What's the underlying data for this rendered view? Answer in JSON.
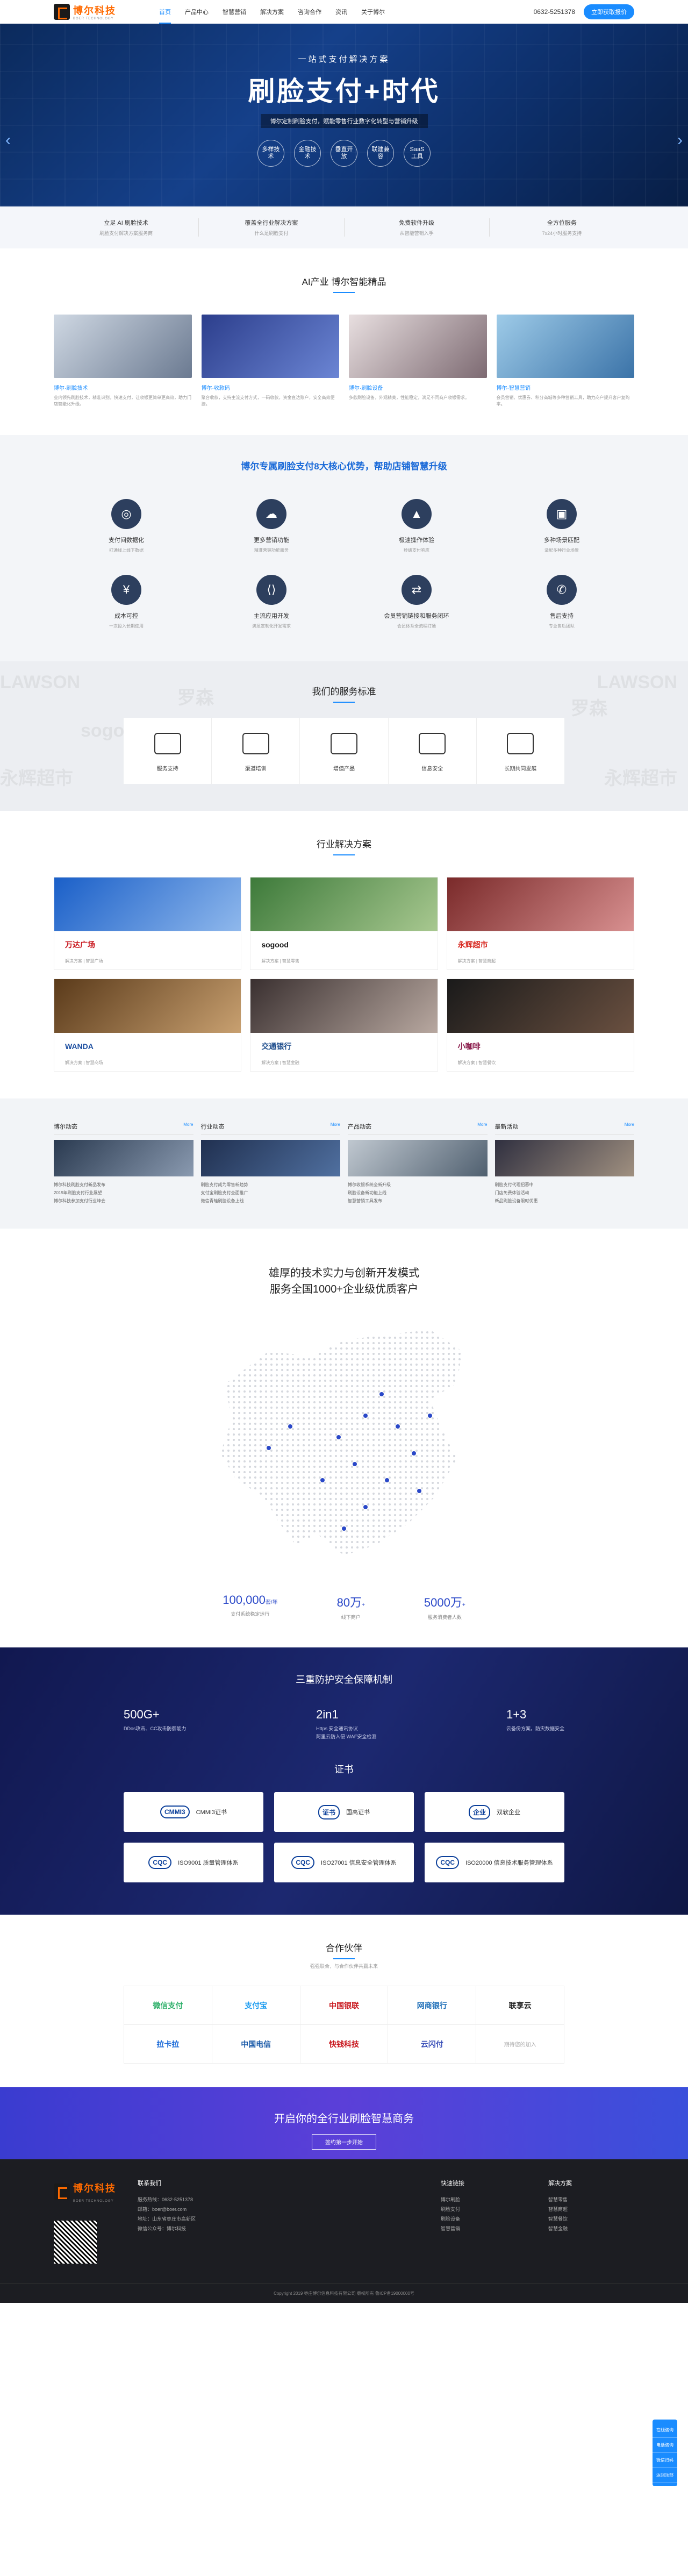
{
  "header": {
    "brand_name": "博尔科技",
    "brand_sub": "BOER TECHNOLOGY",
    "nav": [
      "首页",
      "产品中心",
      "智慧营销",
      "解决方案",
      "咨询合作",
      "资讯",
      "关于博尔"
    ],
    "phone": "0632-5251378",
    "cta": "立即获取报价"
  },
  "banner": {
    "subtitle": "一站式支付解决方案",
    "title": "刷脸支付+时代",
    "desc": "博尔定制刷脸支付，赋能零售行业数字化转型与营销升级",
    "tags": [
      "多样技术",
      "金融技术",
      "垂直开放",
      "联建兼容",
      "SaaS工具"
    ]
  },
  "strip": [
    {
      "t": "立足 AI 刷脸技术",
      "s": "刷脸支付解决方案服务商"
    },
    {
      "t": "覆盖全行业解决方案",
      "s": "什么是刷脸支付"
    },
    {
      "t": "免费软件升级",
      "s": "从智能营销入手"
    },
    {
      "t": "全方位服务",
      "s": "7x24小时服务支持"
    }
  ],
  "products": {
    "title": "AI产业 博尔智能精品",
    "items": [
      {
        "name": "博尔·刷脸技术",
        "desc": "业内领先刷脸技术，精准识别，快速支付，让收银更简单更高效，助力门店智能化升级。"
      },
      {
        "name": "博尔·收款码",
        "desc": "聚合收款，支持主流支付方式，一码收款，资金直达账户，安全高效便捷。"
      },
      {
        "name": "博尔·刷脸设备",
        "desc": "多款刷脸设备，外观精美，性能稳定，满足不同商户收银需求。"
      },
      {
        "name": "博尔·智慧营销",
        "desc": "会员营销、优惠券、积分商城等多种营销工具，助力商户提升客户复购率。"
      }
    ]
  },
  "advantages": {
    "title": "博尔专属刷脸支付8大核心优势，帮助店铺智慧升级",
    "items": [
      {
        "t": "支付间数据化",
        "s": "打通线上线下数据"
      },
      {
        "t": "更多营销功能",
        "s": "精准营销功能服务"
      },
      {
        "t": "极速操作体验",
        "s": "秒级支付响应"
      },
      {
        "t": "多种场景匹配",
        "s": "适配多种行业场景"
      },
      {
        "t": "成本可控",
        "s": "一次投入长期使用"
      },
      {
        "t": "主流应用开发",
        "s": "满足定制化开发需求"
      },
      {
        "t": "会员营销链接和服务闭环",
        "s": "会员体系全流程打通"
      },
      {
        "t": "售后支持",
        "s": "专业售后团队"
      }
    ]
  },
  "service": {
    "title": "我们的服务标准",
    "bg_words": [
      "LAWSON",
      "sogood",
      "LAWSON",
      "永辉超市",
      "永辉超市",
      "罗森",
      "罗森"
    ],
    "items": [
      "服务支持",
      "渠道培训",
      "增值产品",
      "信息安全",
      "长期共同发展"
    ]
  },
  "solutions": {
    "title": "行业解决方案",
    "items": [
      {
        "logo": "万达广场",
        "meta": "解决方案 | 智慧广场"
      },
      {
        "logo": "sogood",
        "meta": "解决方案 | 智慧零售"
      },
      {
        "logo": "永辉超市",
        "meta": "解决方案 | 智慧商超"
      },
      {
        "logo": "WANDA",
        "meta": "解决方案 | 智慧商场"
      },
      {
        "logo": "交通银行",
        "meta": "解决方案 | 智慧金融"
      },
      {
        "logo": "小咖啡",
        "meta": "解决方案 | 智慧餐饮"
      }
    ]
  },
  "news": {
    "more": "More",
    "cols": [
      {
        "title": "博尔动态",
        "items": [
          "博尔科技刷脸支付新品发布",
          "2019年刷脸支付行业展望",
          "博尔科技参加支付行业峰会"
        ]
      },
      {
        "title": "行业动态",
        "items": [
          "刷脸支付成为零售新趋势",
          "支付宝刷脸支付全面推广",
          "微信青蛙刷脸设备上线"
        ]
      },
      {
        "title": "产品动态",
        "items": [
          "博尔收银系统全新升级",
          "刷脸设备新功能上线",
          "智慧营销工具发布"
        ]
      },
      {
        "title": "最新活动",
        "items": [
          "刷脸支付代理招募中",
          "门店免费体验活动",
          "新品刷脸设备限时优惠"
        ]
      }
    ]
  },
  "mapsec": {
    "title_line1": "雄厚的技术实力与创新开发模式",
    "title_line2": "服务全国1000+企业级优质客户",
    "stats": [
      {
        "v": "100,000",
        "u": "套/年",
        "l": "支付系统稳定运行"
      },
      {
        "v": "80万",
        "u": "+",
        "l": "线下商户"
      },
      {
        "v": "5000万",
        "u": "+",
        "l": "服务消费者人数"
      }
    ]
  },
  "security": {
    "title": "三重防护安全保障机制",
    "items": [
      {
        "v": "500G+",
        "d": "DDos攻击、CC攻击防御能力"
      },
      {
        "v": "2in1",
        "d": "Https 安全通讯协议\n阿里云防入侵 WAF安全检测"
      },
      {
        "v": "1+3",
        "d": "云备份方案，防灾数据安全"
      }
    ],
    "cert_title": "证书",
    "certs": [
      {
        "logo": "CMMI3",
        "name": "CMMI3证书"
      },
      {
        "logo": "证书",
        "name": "国高证书"
      },
      {
        "logo": "企业",
        "name": "双软企业"
      },
      {
        "logo": "CQC",
        "name": "ISO9001 质量管理体系"
      },
      {
        "logo": "CQC",
        "name": "ISO27001 信息安全管理体系"
      },
      {
        "logo": "CQC",
        "name": "ISO20000 信息技术服务管理体系"
      }
    ]
  },
  "partners": {
    "title": "合作伙伴",
    "sub": "强强联合，与合作伙伴共赢未来",
    "items": [
      "微信支付",
      "支付宝",
      "中国银联",
      "网商银行",
      "联享云",
      "拉卡拉",
      "中国电信",
      "快钱科技",
      "云闪付",
      "期待您的加入"
    ]
  },
  "cta": {
    "title": "开启你的全行业刷脸智慧商务",
    "button": "签约第一步开始"
  },
  "footer": {
    "contact_title": "联系我们",
    "contact": [
      "服务热线：0632-5251378",
      "邮箱：boer@boer.com",
      "地址：山东省枣庄市高新区",
      "微信公众号：博尔科技"
    ],
    "links_title": "快速链接",
    "links": [
      "博尔刷脸",
      "刷脸支付",
      "刷脸设备",
      "智慧营销"
    ],
    "sol_title": "解决方案",
    "sols": [
      "智慧零售",
      "智慧商超",
      "智慧餐饮",
      "智慧金融"
    ],
    "copyright": "Copyright 2019 枣庄博尔信息科技有限公司 版权所有 鲁ICP备19000000号"
  },
  "float": [
    "在线咨询",
    "电话咨询",
    "微信扫码",
    "返回顶部"
  ]
}
